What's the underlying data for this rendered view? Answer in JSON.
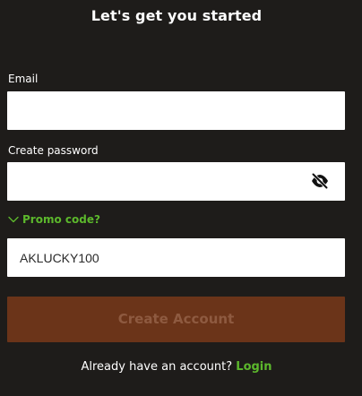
{
  "form": {
    "title": "Let's get you started",
    "email": {
      "label": "Email",
      "value": ""
    },
    "password": {
      "label": "Create password",
      "value": "",
      "toggle_icon": "eye-slash-icon"
    },
    "promo": {
      "toggle_label": "Promo code?",
      "value": "AKLUCKY100"
    },
    "submit_label": "Create Account",
    "footer": {
      "text": "Already have an account?",
      "login_label": "Login"
    }
  },
  "colors": {
    "background": "#1e1c1a",
    "accent_green": "#5cb82c",
    "button_bg": "#6b3419",
    "button_text": "#8e5a40"
  }
}
